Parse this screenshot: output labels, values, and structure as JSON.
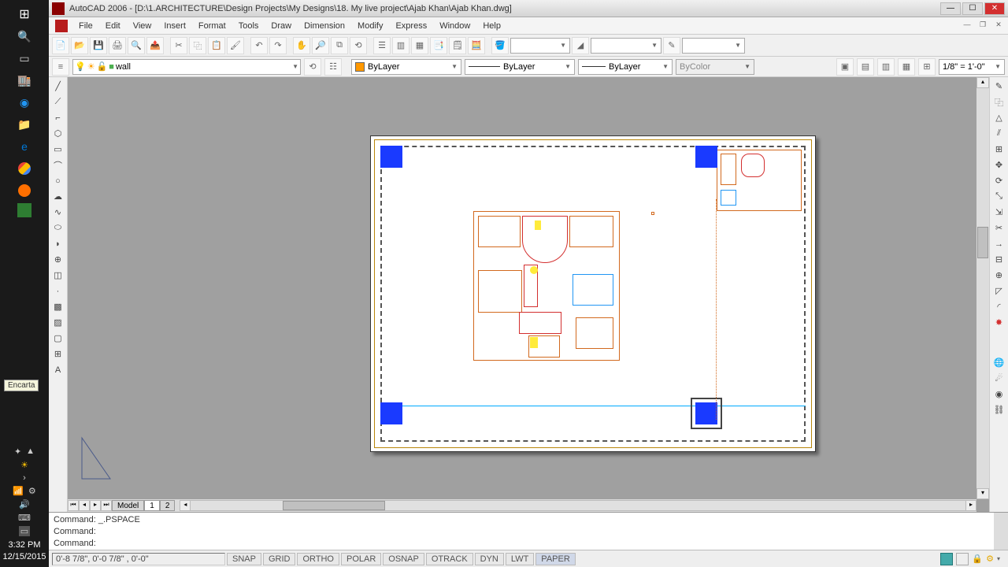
{
  "taskbar": {
    "tooltip": "Encarta",
    "time": "3:32 PM",
    "date": "12/15/2015"
  },
  "title": "AutoCAD 2006 - [D:\\1.ARCHITECTURE\\Design Projects\\My Designs\\18. My live project\\Ajab Khan\\Ajab Khan.dwg]",
  "menu": [
    "File",
    "Edit",
    "View",
    "Insert",
    "Format",
    "Tools",
    "Draw",
    "Dimension",
    "Modify",
    "Express",
    "Window",
    "Help"
  ],
  "layer": {
    "name": "wall",
    "color_combo": "ByLayer",
    "linetype": "ByLayer",
    "lineweight": "ByLayer",
    "plotstyle": "ByColor",
    "scale": "1/8\" = 1'-0\""
  },
  "layout_tabs": {
    "model": "Model",
    "tabs": [
      "1",
      "2"
    ]
  },
  "command": {
    "line1": "Command: _.PSPACE",
    "line2": "Command:",
    "line3": "Command:"
  },
  "status": {
    "coords": "0'-8 7/8\",   0'-0 7/8\"  , 0'-0\"",
    "toggles": [
      "SNAP",
      "GRID",
      "ORTHO",
      "POLAR",
      "OSNAP",
      "OTRACK",
      "DYN",
      "LWT",
      "PAPER"
    ]
  },
  "chart_data": null
}
